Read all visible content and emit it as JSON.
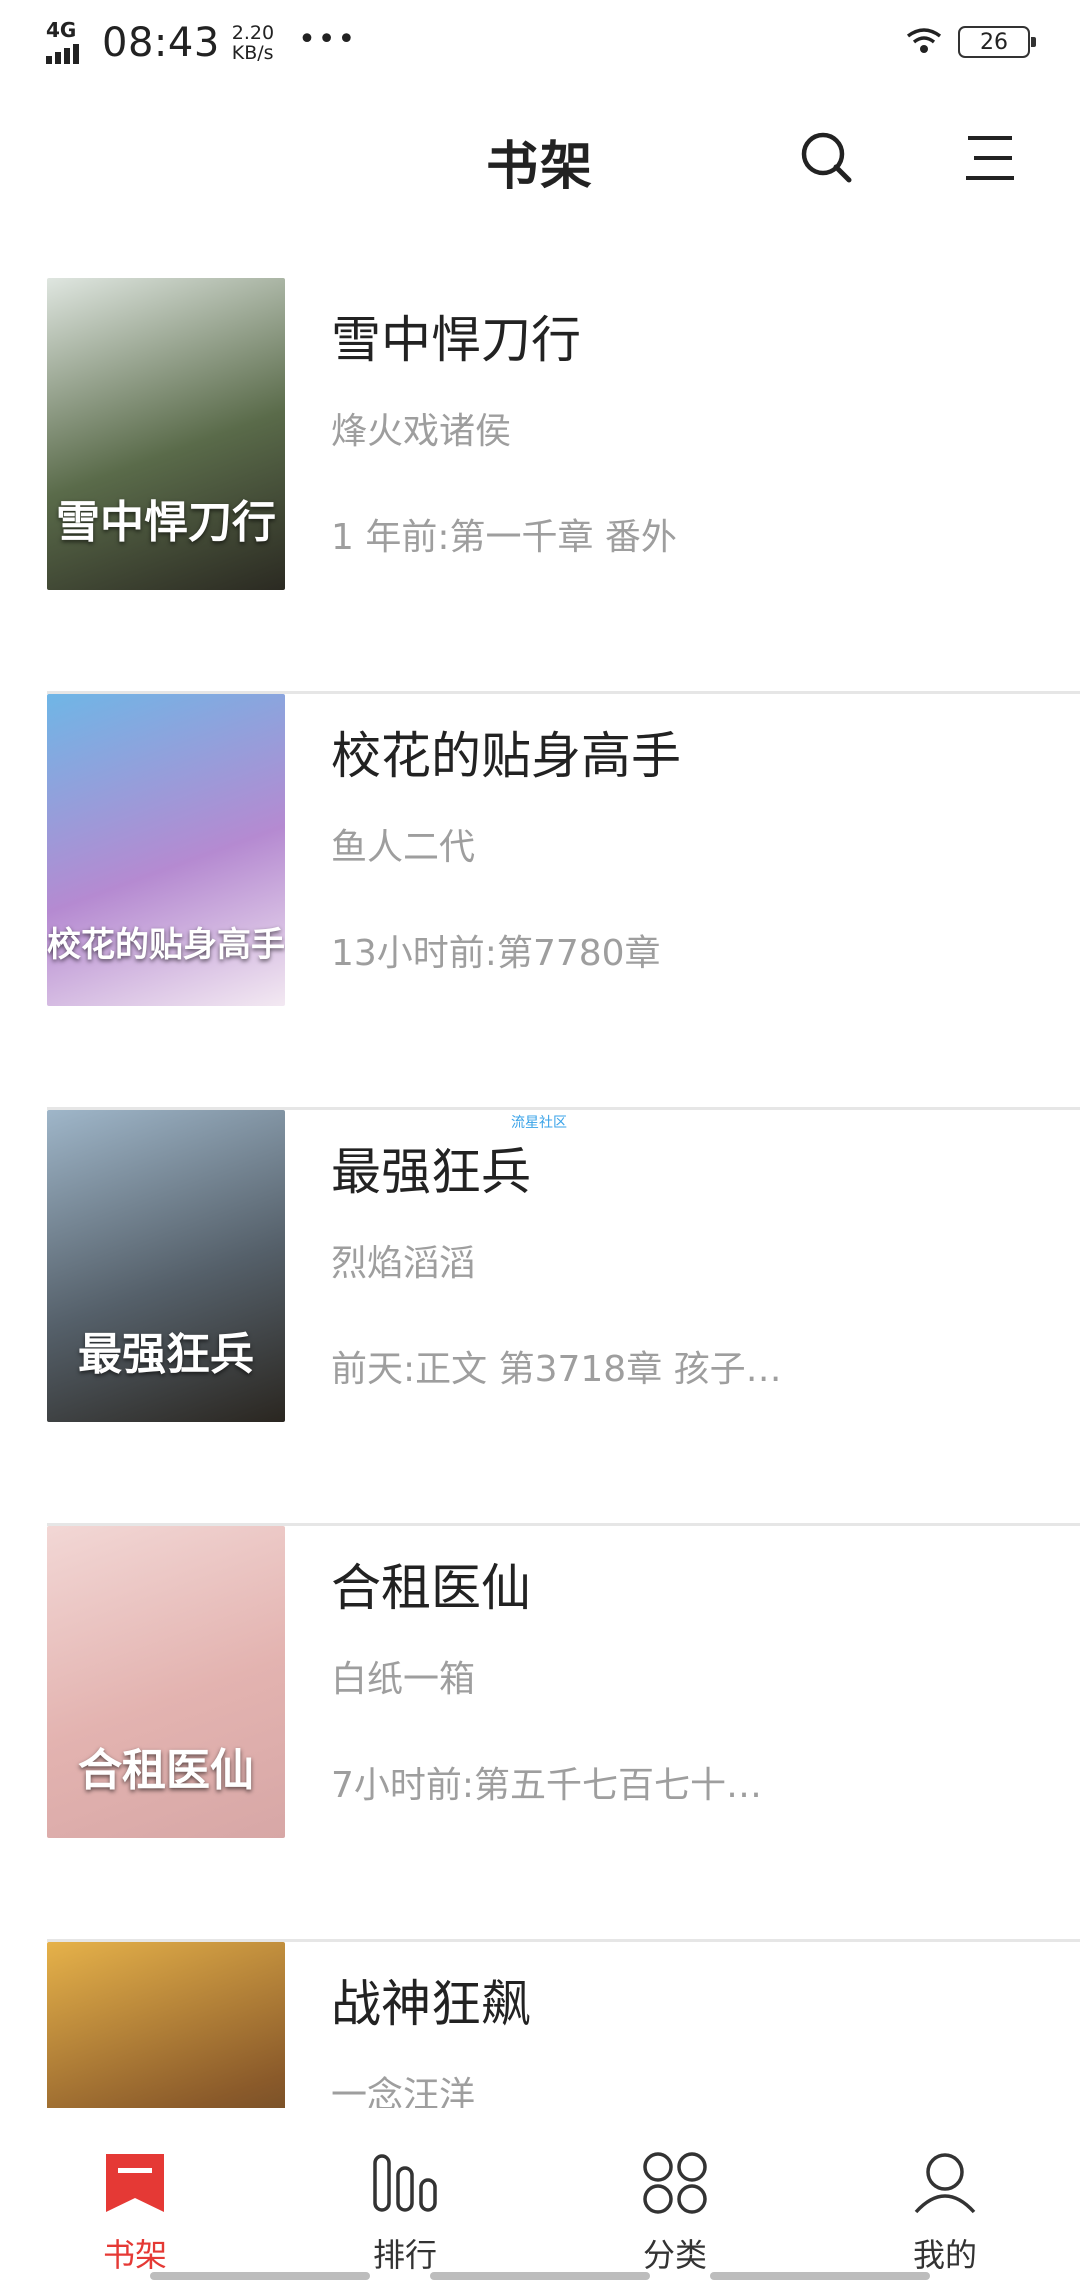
{
  "status_bar": {
    "network": "4G",
    "time": "08:43",
    "speed_value": "2.20",
    "speed_unit": "KB/s",
    "battery": "26"
  },
  "header": {
    "title": "书架"
  },
  "books": [
    {
      "title": "雪中悍刀行",
      "author": "烽火戏诸侯",
      "latest": "1 年前:第一千章 番外",
      "cover_text": "雪中悍刀行",
      "cover_colors": [
        "#dfe6e0",
        "#5a6b4a",
        "#2b2a22"
      ]
    },
    {
      "title": "校花的贴身高手",
      "author": "鱼人二代",
      "latest": "13小时前:第7780章",
      "cover_text": "校花的贴身高手",
      "cover_colors": [
        "#6fb6e6",
        "#b58ad1",
        "#f3e9f2"
      ]
    },
    {
      "title": "最强狂兵",
      "author": "烈焰滔滔",
      "latest": "前天:正文 第3718章 孩子…",
      "cover_text": "最强狂兵",
      "cover_colors": [
        "#9fb6c9",
        "#55606a",
        "#2a2620"
      ]
    },
    {
      "title": "合租医仙",
      "author": "白纸一箱",
      "latest": "7小时前:第五千七百七十…",
      "cover_text": "合租医仙",
      "cover_colors": [
        "#f2d7d5",
        "#e3b3b0",
        "#d7a7a6"
      ]
    },
    {
      "title": "战神狂飙",
      "author": "一念汪洋",
      "latest": "",
      "cover_text": "",
      "cover_colors": [
        "#e6b24a",
        "#8a5a2a",
        "#3c2f22"
      ]
    }
  ],
  "bottom_nav": [
    {
      "label": "书架",
      "icon": "bookshelf-icon",
      "active": true
    },
    {
      "label": "排行",
      "icon": "ranking-icon",
      "active": false
    },
    {
      "label": "分类",
      "icon": "category-icon",
      "active": false
    },
    {
      "label": "我的",
      "icon": "profile-icon",
      "active": false
    }
  ],
  "colors": {
    "accent": "#e53935",
    "secondary_text": "#9e9e9e",
    "divider": "#e6e6e6"
  }
}
